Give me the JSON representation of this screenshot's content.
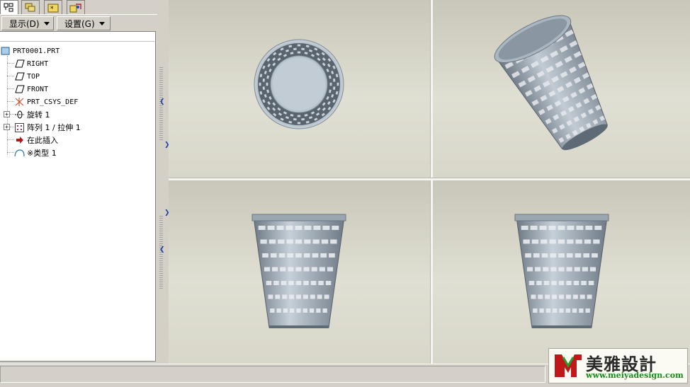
{
  "menu_buttons": {
    "display": "显示(D)",
    "settings": "设置(G)"
  },
  "model_tree": {
    "root": "PRT0001.PRT",
    "items": [
      {
        "label": "RIGHT",
        "icon": "datum-plane-icon"
      },
      {
        "label": "TOP",
        "icon": "datum-plane-icon"
      },
      {
        "label": "FRONT",
        "icon": "datum-plane-icon"
      },
      {
        "label": "PRT_CSYS_DEF",
        "icon": "coordinate-system-icon"
      },
      {
        "label": "旋转 1",
        "icon": "revolve-icon",
        "expandable": true
      },
      {
        "label": "阵列 1 / 拉伸 1",
        "icon": "pattern-icon",
        "expandable": true
      },
      {
        "label": "在此插入",
        "icon": "insert-here-arrow-icon"
      },
      {
        "label": "※类型 1",
        "icon": "style-feature-icon"
      }
    ]
  },
  "watermark": {
    "brand": "美雅設計",
    "url": "www.meiyadesign.com"
  },
  "colors": {
    "model_steel": "#7e8a96",
    "model_highlight": "#c5cfd8",
    "insert_arrow": "#b01818",
    "watermark_url": "#1b8a1b"
  }
}
